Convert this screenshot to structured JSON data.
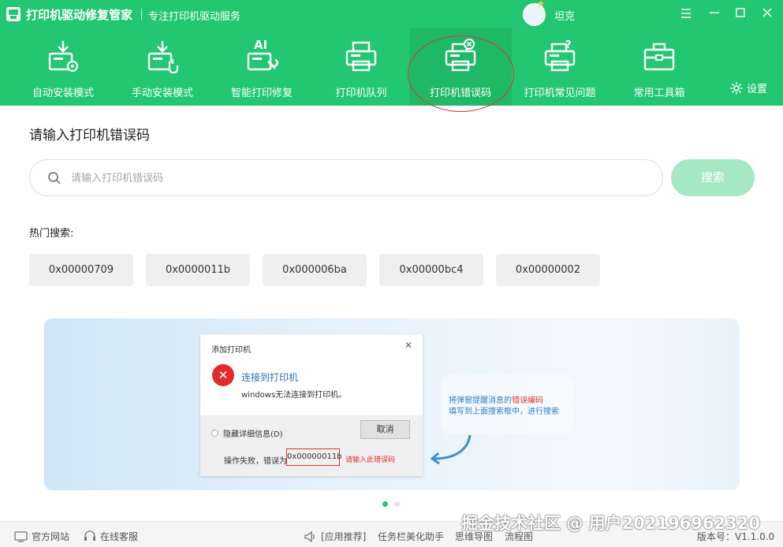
{
  "titlebar": {
    "app_title": "打印机驱动修复管家",
    "subtitle": "专注打印机驱动服务",
    "user_name": "坦克",
    "minimize_symbol": "—",
    "maximize_symbol": "☐",
    "close_symbol": "✕"
  },
  "nav": {
    "items": [
      {
        "label": "自动安装模式",
        "icon": "auto-install-icon"
      },
      {
        "label": "手动安装模式",
        "icon": "manual-install-icon"
      },
      {
        "label": "智能打印修复",
        "icon": "ai-repair-icon"
      },
      {
        "label": "打印机队列",
        "icon": "printer-queue-icon"
      },
      {
        "label": "打印机错误码",
        "icon": "printer-error-icon",
        "active": true
      },
      {
        "label": "打印机常见问题",
        "icon": "printer-faq-icon"
      },
      {
        "label": "常用工具箱",
        "icon": "toolbox-icon"
      }
    ],
    "settings_label": "设置"
  },
  "main": {
    "section_title": "请输入打印机错误码",
    "search_placeholder": "请输入打印机错误码",
    "search_value": "",
    "search_button": "搜索",
    "hot_label": "热门搜索:",
    "hot_codes": [
      "0x00000709",
      "0x0000011b",
      "0x000006ba",
      "0x00000bc4",
      "0x00000002"
    ]
  },
  "illustration": {
    "dialog_title": "添加打印机",
    "dialog_close": "✕",
    "dialog_heading": "连接到打印机",
    "dialog_message": "windows无法连接到打印机。",
    "details_toggle": "隐藏详细信息(D)",
    "cancel_button": "取消",
    "fail_text": "操作失败，错误为",
    "error_code": "0x00000011b",
    "hint_text": "请输入此错误码",
    "tip_line1_a": "将弹窗提醒消息的",
    "tip_line1_b": "错误编码",
    "tip_line2": "填写到上面搜索框中，进行搜索"
  },
  "carousel": {
    "active_index": 0,
    "count": 2
  },
  "footer": {
    "website": "官方网站",
    "support": "在线客服",
    "recommend": "[应用推荐]",
    "app1": "任务栏美化助手",
    "app2": "思维导图",
    "app3": "流程图",
    "version": "版本号：V1.1.0.0"
  },
  "watermark": "掘金技术社区 @ 用户2021969623​20",
  "colors": {
    "brand": "#23c771",
    "brand_active": "#1fb866",
    "search_button": "#a6e8c4",
    "error_red": "#e03030",
    "link_blue": "#2b7fd0"
  }
}
